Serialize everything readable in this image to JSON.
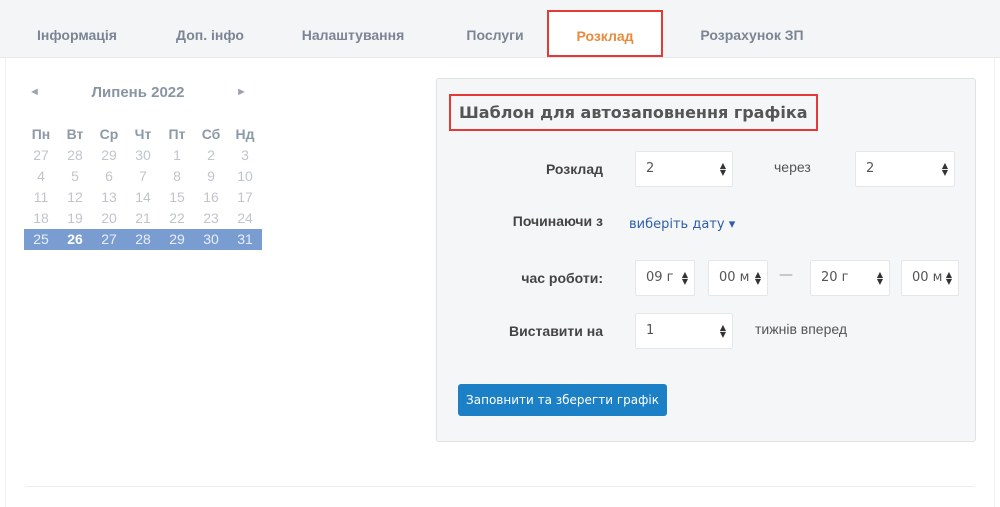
{
  "tabs": [
    {
      "label": "Інформація"
    },
    {
      "label": "Доп. інфо"
    },
    {
      "label": "Налаштування"
    },
    {
      "label": "Послуги"
    },
    {
      "label": "Розклад"
    },
    {
      "label": "Розрахунок ЗП"
    }
  ],
  "calendar": {
    "prev": "◄",
    "next": "►",
    "month": "Липень 2022",
    "weekdays": [
      "Пн",
      "Вт",
      "Ср",
      "Чт",
      "Пт",
      "Сб",
      "Нд"
    ],
    "weeks": [
      [
        "27",
        "28",
        "29",
        "30",
        "1",
        "2",
        "3"
      ],
      [
        "4",
        "5",
        "6",
        "7",
        "8",
        "9",
        "10"
      ],
      [
        "11",
        "12",
        "13",
        "14",
        "15",
        "16",
        "17"
      ],
      [
        "18",
        "19",
        "20",
        "21",
        "22",
        "23",
        "24"
      ],
      [
        "25",
        "26",
        "27",
        "28",
        "29",
        "30",
        "31"
      ]
    ]
  },
  "panel": {
    "title": "Шаблон для автозаповнення графіка",
    "schedule_label": "Розклад",
    "schedule_value": "2",
    "through_label": "через",
    "through_value": "2",
    "starting_label": "Починаючи з",
    "pick_date": "виберіть дату ▾",
    "work_time_label": "час роботи:",
    "from_hour": "09 г",
    "from_min": "00 м",
    "dash": "—",
    "to_hour": "20 г",
    "to_min": "00 м",
    "set_for_label": "Виставити на",
    "weeks_value": "1",
    "weeks_ahead": "тижнів вперед",
    "submit": "Заповнити та зберегти графік"
  },
  "icons": {
    "select_arrow": "updown-arrow-icon"
  }
}
